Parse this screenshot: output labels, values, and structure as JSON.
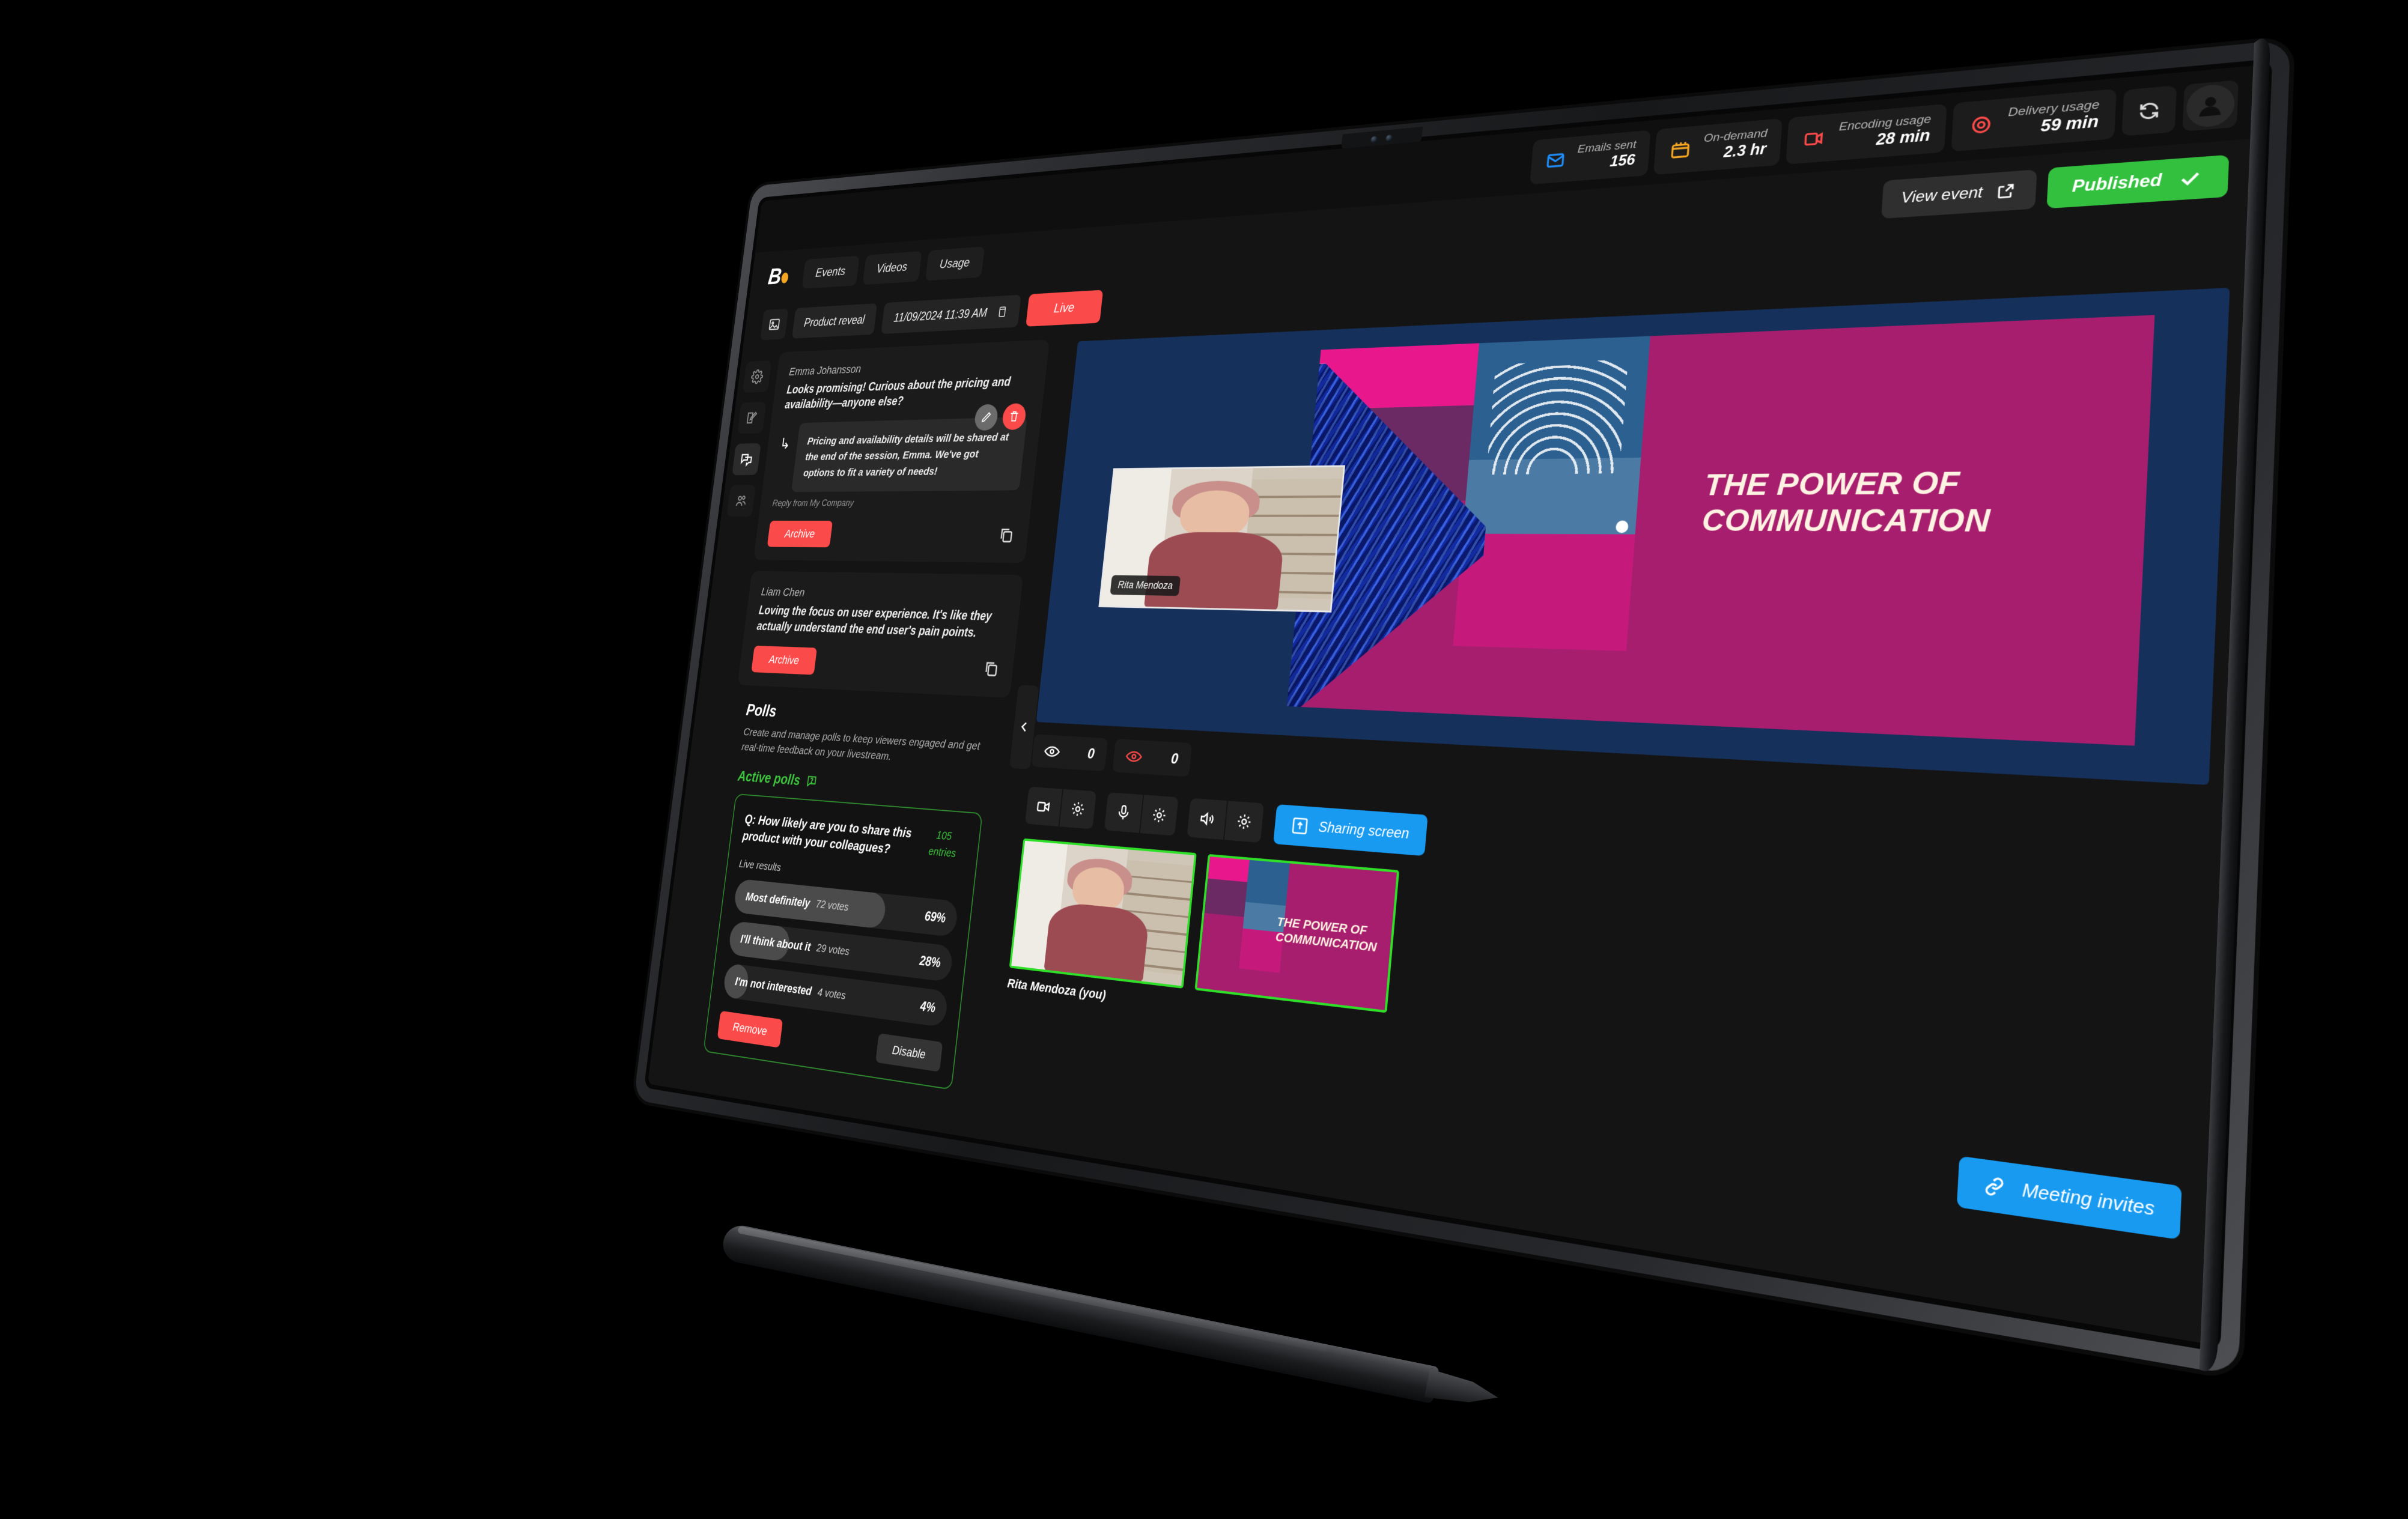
{
  "topbar": {
    "stats": [
      {
        "icon": "mail-icon",
        "label": "Emails sent",
        "value": "156",
        "color": "#1e90ff"
      },
      {
        "icon": "calendar-icon",
        "label": "On-demand",
        "value": "2.3 hr",
        "color": "#f5a623"
      },
      {
        "icon": "video-icon",
        "label": "Encoding usage",
        "value": "28 min",
        "color": "#fb4a4a"
      },
      {
        "icon": "target-icon",
        "label": "Delivery usage",
        "value": "59 min",
        "color": "#fb4a4a"
      }
    ],
    "refresh_icon": "refresh-icon",
    "avatar_icon": "user-avatar-icon"
  },
  "nav": {
    "logo": "B",
    "tabs": [
      "Events",
      "Videos",
      "Usage"
    ],
    "view_event": "View event",
    "published": "Published"
  },
  "event": {
    "title": "Product reveal",
    "datetime": "11/09/2024 11:39 AM",
    "status": "Live"
  },
  "rail": {
    "items": [
      "settings-icon",
      "edit-icon",
      "chat-icon",
      "audience-icon"
    ],
    "active_index": 2
  },
  "comments": [
    {
      "author": "Emma Johansson",
      "text": "Looks promising! Curious about the pricing and availability—anyone else?",
      "reply": "Pricing and availability details will be shared at the end of the session, Emma. We've got options to fit a variety of needs!",
      "reply_from": "Reply from My Company",
      "archive_label": "Archive"
    },
    {
      "author": "Liam Chen",
      "text": "Loving the focus on user experience. It's like they actually understand the end user's pain points.",
      "archive_label": "Archive"
    }
  ],
  "polls": {
    "heading": "Polls",
    "description": "Create and manage polls to keep viewers engaged and get real-time feedback on your livestream.",
    "active_label": "Active polls",
    "question": "Q: How likely are you to share this product with your colleagues?",
    "entries_count": "105",
    "entries_label": "entries",
    "live_results_label": "Live results",
    "options": [
      {
        "label": "Most definitely",
        "votes": "72 votes",
        "pct": "69%",
        "pct_value": 69
      },
      {
        "label": "I'll think about it",
        "votes": "29 votes",
        "pct": "28%",
        "pct_value": 28
      },
      {
        "label": "I'm not interested",
        "votes": "4 votes",
        "pct": "4%",
        "pct_value": 4
      }
    ],
    "remove_label": "Remove",
    "disable_label": "Disable",
    "accent_color": "#3ec63e"
  },
  "stage": {
    "slide_title": "THE POWER OF COMMUNICATION",
    "pip_name": "Rita Mendoza"
  },
  "viewers": [
    {
      "icon": "eye-icon",
      "count": "0"
    },
    {
      "icon": "eye-live-icon",
      "count": "0"
    }
  ],
  "controls": {
    "groups": [
      [
        "camera-icon",
        "gear-icon"
      ],
      [
        "microphone-icon",
        "gear-icon"
      ],
      [
        "speaker-icon",
        "gear-icon"
      ]
    ],
    "sharing_label": "Sharing screen"
  },
  "thumbnails": [
    {
      "name": "Rita Mendoza (you)",
      "type": "webcam"
    },
    {
      "name": "",
      "type": "slide",
      "title": "THE POWER OF COMMUNICATION"
    }
  ],
  "invites": {
    "label": "Meeting invites",
    "icon": "link-icon"
  },
  "collapse": {
    "icon": "chevron-left-icon"
  }
}
